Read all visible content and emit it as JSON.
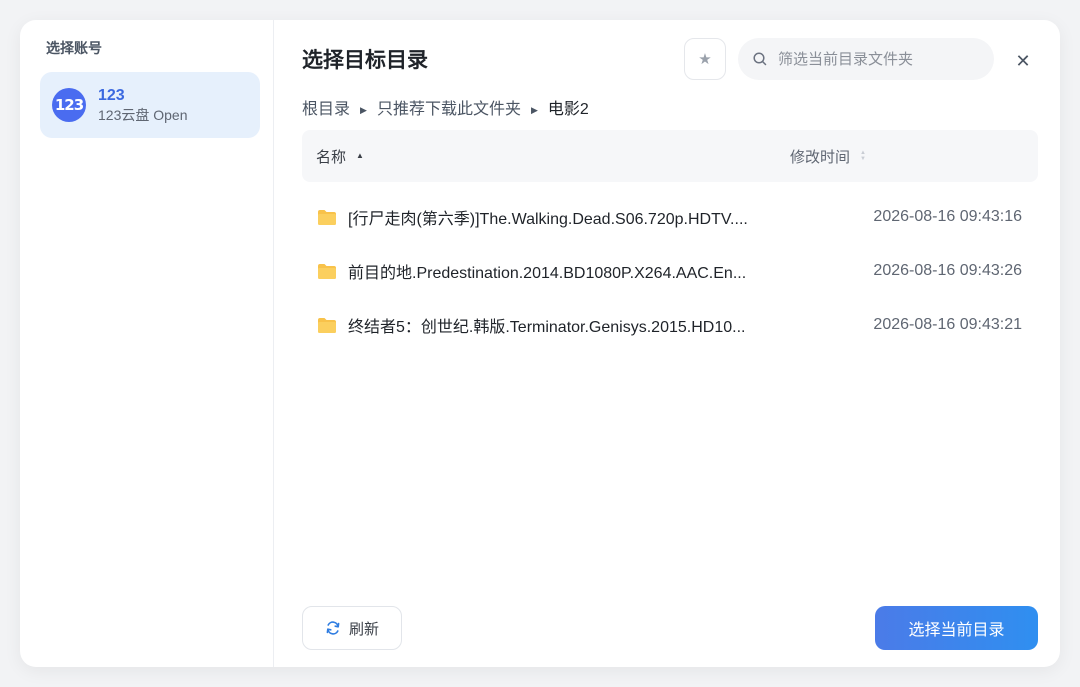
{
  "sidebar": {
    "title": "选择账号",
    "accounts": [
      {
        "logo_text": "123",
        "name": "123",
        "subtitle": "123云盘 Open"
      }
    ]
  },
  "dialog": {
    "title": "选择目标目录",
    "search_placeholder": "筛选当前目录文件夹",
    "close_glyph": "✕",
    "star_glyph": "★"
  },
  "breadcrumb": [
    "根目录",
    "只推荐下载此文件夹",
    "电影2"
  ],
  "table": {
    "columns": {
      "name": "名称",
      "modified": "修改时间"
    },
    "rows": [
      {
        "name": "[行尸走肉(第六季)]The.Walking.Dead.S06.720p.HDTV....",
        "modified": "2026-08-16 09:43:16"
      },
      {
        "name": "前目的地.Predestination.2014.BD1080P.X264.AAC.En...",
        "modified": "2026-08-16 09:43:26"
      },
      {
        "name": "终结者5：创世纪.韩版.Terminator.Genisys.2015.HD10...",
        "modified": "2026-08-16 09:43:21"
      }
    ]
  },
  "footer": {
    "refresh_label": "刷新",
    "confirm_label": "选择当前目录"
  },
  "colors": {
    "accent": "#3b69e0",
    "account_bg": "#e6f0fc",
    "folder": "#f8c24a"
  }
}
